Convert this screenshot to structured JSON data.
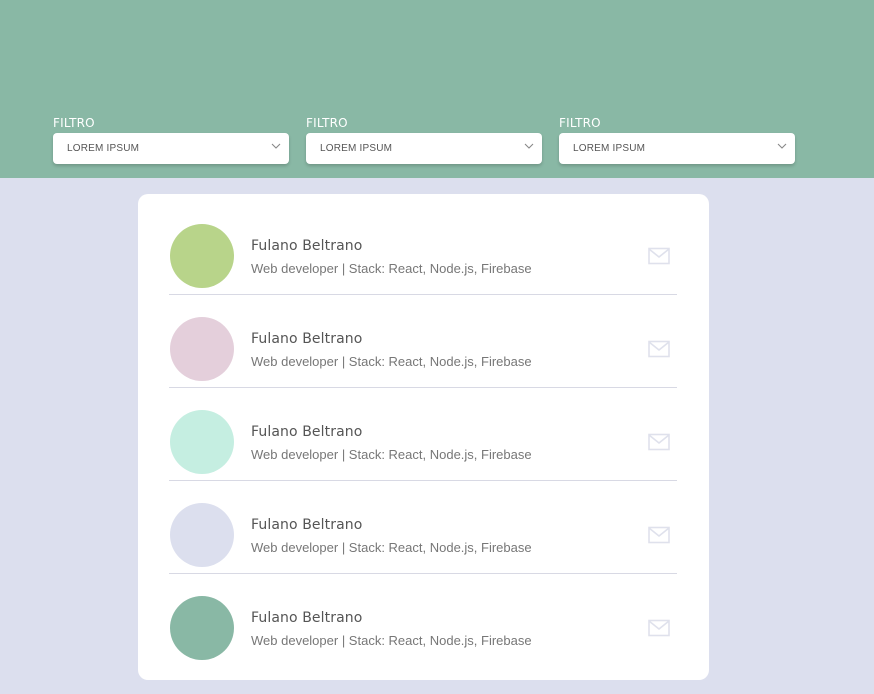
{
  "filters": [
    {
      "label": "FILTRO",
      "value": "LOREM IPSUM"
    },
    {
      "label": "FILTRO",
      "value": "LOREM IPSUM"
    },
    {
      "label": "FILTRO",
      "value": "LOREM IPSUM"
    }
  ],
  "people": [
    {
      "name": "Fulano Beltrano",
      "role": "Web developer | Stack: React, Node.js, Firebase",
      "avatar_color": "#b8d48a"
    },
    {
      "name": "Fulano Beltrano",
      "role": "Web developer | Stack: React, Node.js, Firebase",
      "avatar_color": "#e4cfdb"
    },
    {
      "name": "Fulano Beltrano",
      "role": "Web developer | Stack: React, Node.js, Firebase",
      "avatar_color": "#c5eee1"
    },
    {
      "name": "Fulano Beltrano",
      "role": "Web developer | Stack: React, Node.js, Firebase",
      "avatar_color": "#dcdfee"
    },
    {
      "name": "Fulano Beltrano",
      "role": "Web developer | Stack: React, Node.js, Firebase",
      "avatar_color": "#89b8a5"
    }
  ],
  "colors": {
    "header": "#89b8a5",
    "background": "#dcdfee",
    "icon": "#dfe1ec"
  },
  "icons": {
    "select": "chevron-down-icon",
    "contact": "mail-icon"
  }
}
